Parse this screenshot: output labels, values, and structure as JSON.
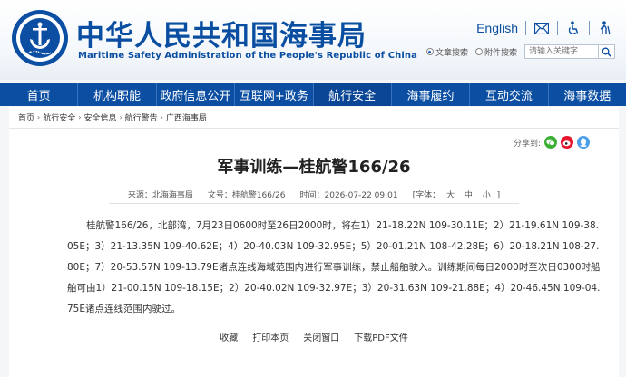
{
  "header": {
    "title_cn": "中华人民共和国海事局",
    "title_en": "Maritime Safety Administration of the People's Republic of China",
    "logo_text": "CHINA MSA",
    "english_link": "English",
    "icons": [
      "mail-icon",
      "accessibility-icon",
      "elder-mode-icon"
    ],
    "search": {
      "radio_options": [
        {
          "label": "文章搜索",
          "selected": true
        },
        {
          "label": "附件搜索",
          "selected": false
        }
      ],
      "placeholder": "请输入关键字"
    }
  },
  "nav": {
    "items": [
      "首页",
      "机构职能",
      "政府信息公开",
      "互联网+政务",
      "航行安全",
      "海事履约",
      "互动交流",
      "海事数据"
    ]
  },
  "breadcrumb": [
    "首页",
    "航行安全",
    "安全信息",
    "航行警告",
    "广西海事局"
  ],
  "article": {
    "share_label": "分享到:",
    "title": "军事训练—桂航警166/26",
    "source": "来源：北海海事局",
    "doc_no": "文号：桂航警166/26",
    "time": "时间：2026-07-22 09:01",
    "font_label": "[字体：",
    "font_sizes": [
      "大",
      "中",
      "小"
    ],
    "font_close": "]",
    "body": "桂航警166/26，北部湾，7月23日0600时至26日2000时，将在1）21-18.22N 109-30.11E；2）21-19.61N 109-38.05E；3）21-13.35N 109-40.62E；4）20-40.03N 109-32.95E；5）20-01.21N 108-42.28E；6）20-18.21N 108-27.80E；7）20-53.57N 109-13.79E诸点连线海域范围内进行军事训练，禁止船舶驶入。训练期间每日2000时至次日0300时船舶可由1）21-00.15N 109-18.15E；2）20-40.02N 109-32.97E；3）20-31.63N 109-21.88E；4）20-46.45N 109-04.75E诸点连线范围内驶过。",
    "actions": [
      "收藏",
      "打印本页",
      "关闭窗口",
      "下载PDF文件"
    ]
  },
  "colors": {
    "brand_blue": "#0b4ea2",
    "wechat_green": "#3cb034",
    "weibo_red": "#e6162d",
    "qq_blue": "#4a9fe8"
  }
}
